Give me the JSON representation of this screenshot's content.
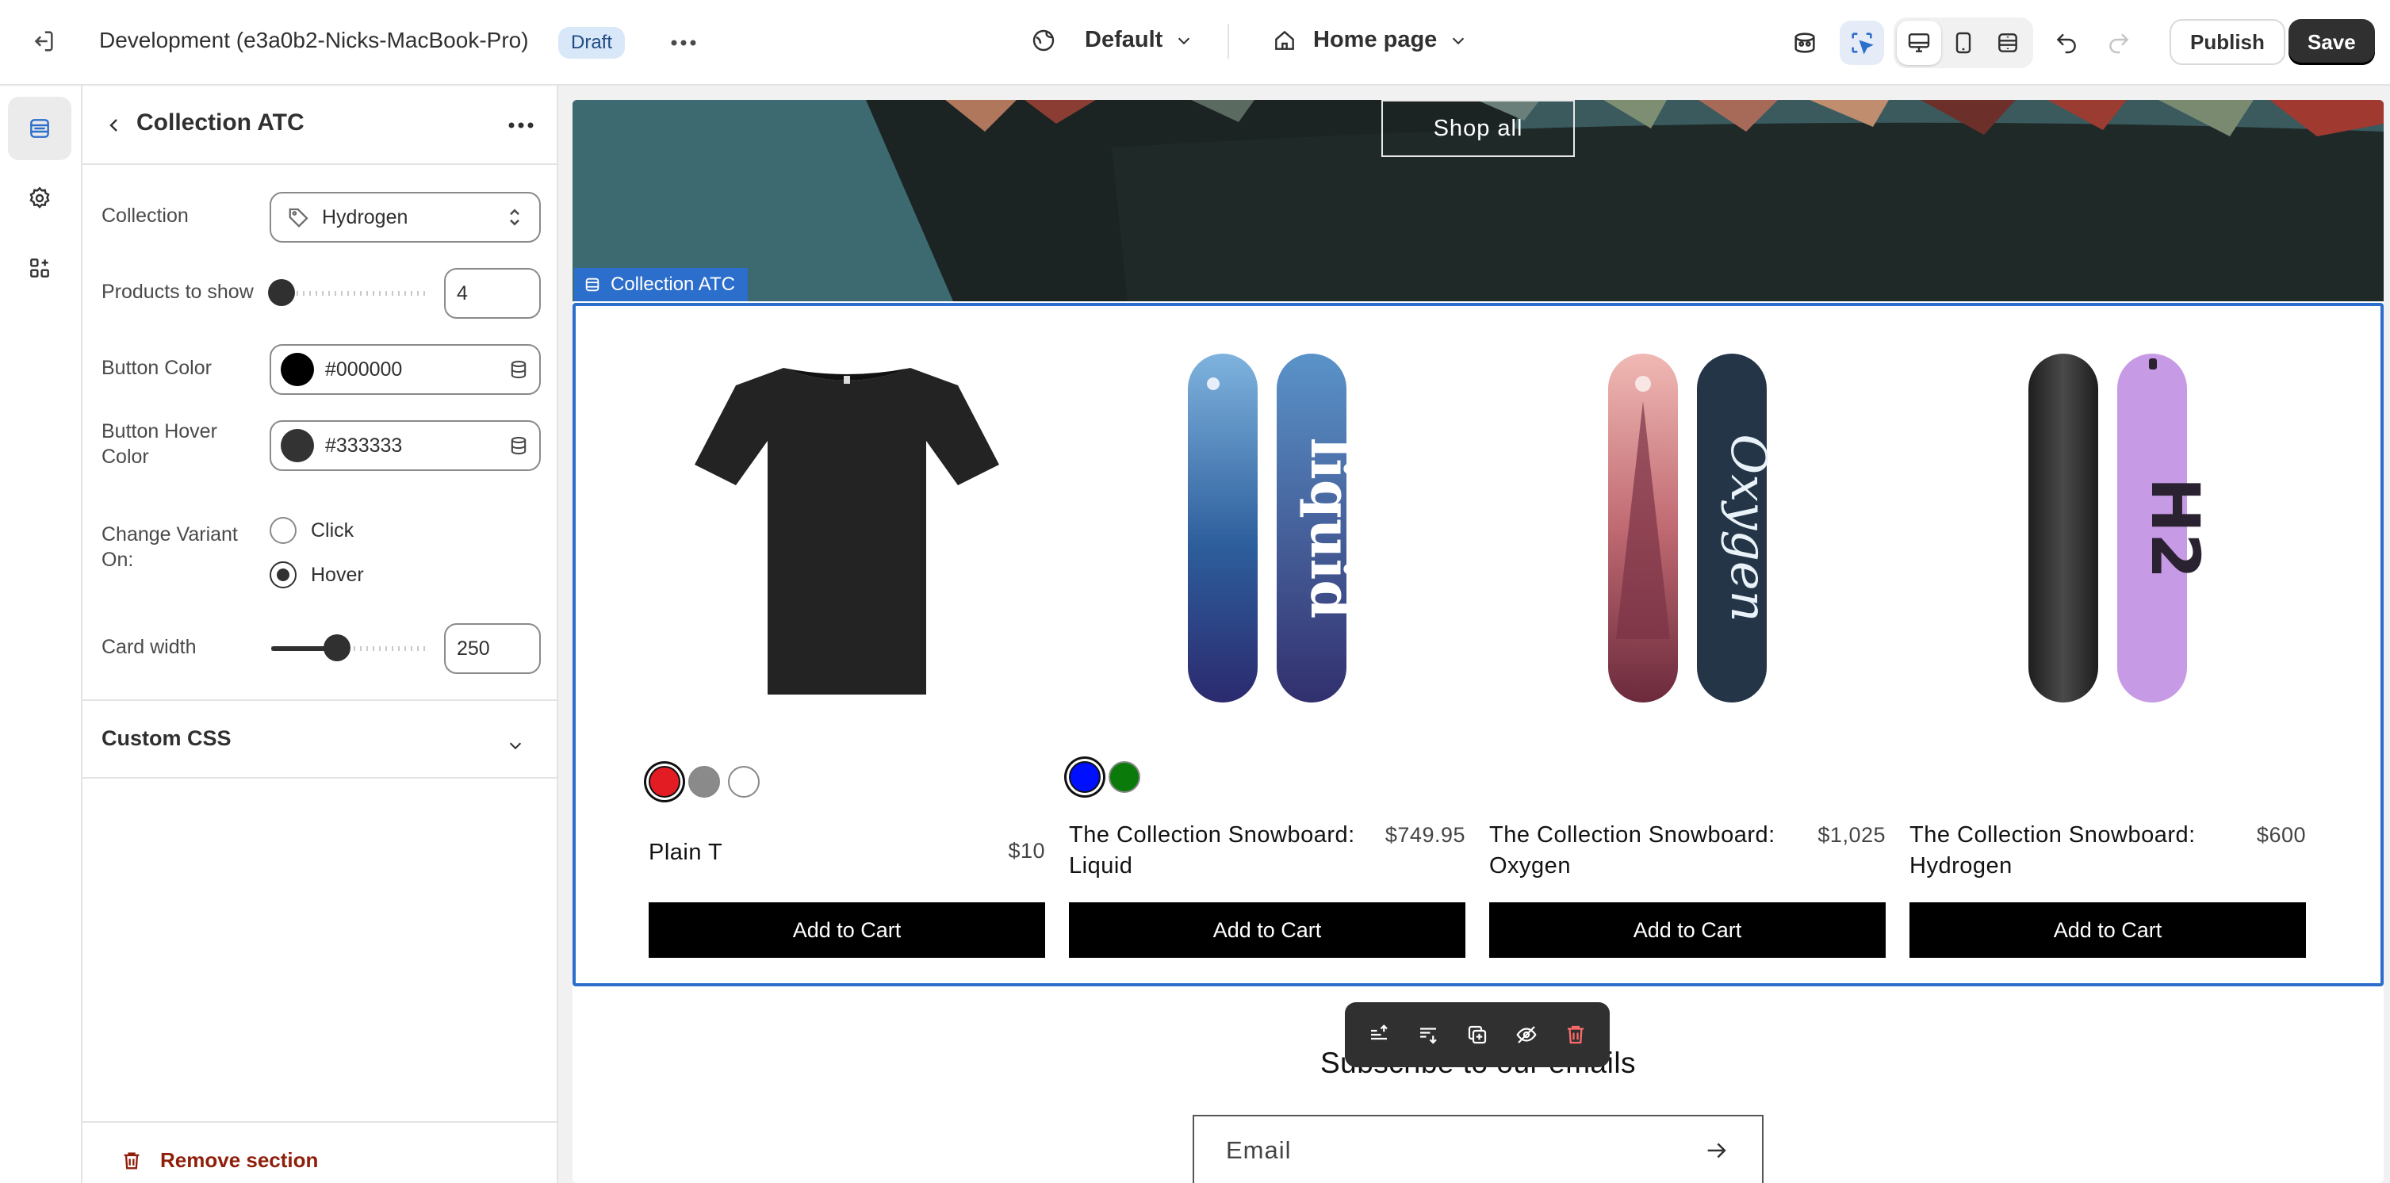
{
  "topbar": {
    "store_name": "Development (e3a0b2-Nicks-MacBook-Pro)",
    "status_badge": "Draft",
    "theme_selector": "Default",
    "page_selector": "Home page",
    "publish_label": "Publish",
    "save_label": "Save"
  },
  "panel": {
    "title": "Collection ATC",
    "collection_label": "Collection",
    "collection_value": "Hydrogen",
    "products_label": "Products to show",
    "products_value": "4",
    "button_color_label": "Button Color",
    "button_color_value": "#000000",
    "button_hover_label": "Button Hover Color",
    "button_hover_value": "#333333",
    "change_variant_label": "Change Variant On:",
    "change_variant_options": [
      "Click",
      "Hover"
    ],
    "change_variant_selected": "Hover",
    "card_width_label": "Card width",
    "card_width_value": "250",
    "custom_css_label": "Custom CSS",
    "remove_label": "Remove section"
  },
  "preview": {
    "shop_all_label": "Shop all",
    "section_tag": "Collection ATC",
    "products": [
      {
        "name": "Plain T",
        "price": "$10",
        "button": "Add to Cart",
        "swatches": [
          "#e31b23",
          "#8a8a8a",
          "#ffffff"
        ],
        "selected_swatch": 0
      },
      {
        "name": "The Collection Snowboard: Liquid",
        "price": "$749.95",
        "button": "Add to Cart",
        "swatches": [
          "#0010ff",
          "#0a7a0a"
        ],
        "selected_swatch": 0
      },
      {
        "name": "The Collection Snowboard: Oxygen",
        "price": "$1,025",
        "button": "Add to Cart",
        "swatches": [],
        "selected_swatch": null
      },
      {
        "name": "The Collection Snowboard: Hydrogen",
        "price": "$600",
        "button": "Add to Cart",
        "swatches": [],
        "selected_swatch": null
      }
    ],
    "subscribe_title": "Subscribe to our emails",
    "email_placeholder": "Email"
  },
  "colors": {
    "accent": "#2c6ecb",
    "button": "#000000",
    "remove": "#8e1f0b"
  }
}
